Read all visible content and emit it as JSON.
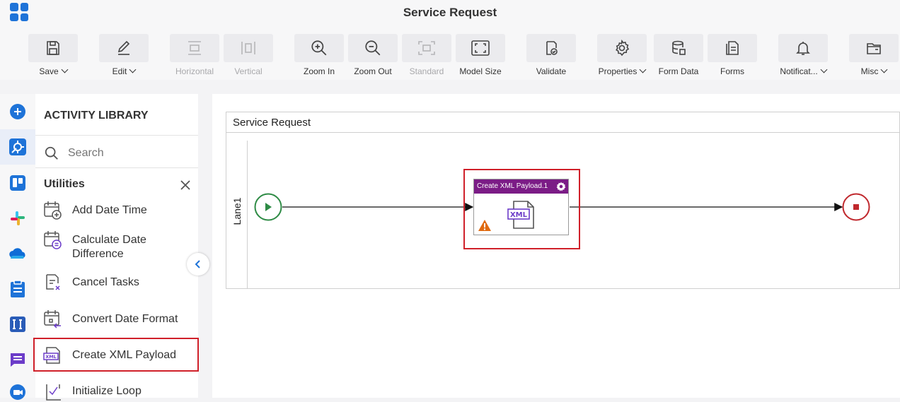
{
  "window": {
    "title": "Service Request"
  },
  "toolbar": {
    "save": "Save",
    "edit": "Edit",
    "horizontal": "Horizontal",
    "vertical": "Vertical",
    "zoom_in": "Zoom In",
    "zoom_out": "Zoom Out",
    "standard": "Standard",
    "model_size": "Model Size",
    "validate": "Validate",
    "properties": "Properties",
    "form_data": "Form Data",
    "forms": "Forms",
    "notifications": "Notificat...",
    "misc": "Misc"
  },
  "leftnav": {
    "icons": [
      "plus-circle-icon",
      "wrench-gear-icon",
      "trello-icon",
      "slack-icon",
      "onedrive-cloud-icon",
      "clipboard-icon",
      "text-input-icon",
      "chat-icon",
      "video-icon"
    ]
  },
  "library": {
    "title": "ACTIVITY LIBRARY",
    "search_placeholder": "Search",
    "group": "Utilities",
    "items": [
      {
        "label": "Add Date Time"
      },
      {
        "label": "Calculate Date\nDifference"
      },
      {
        "label": "Cancel Tasks"
      },
      {
        "label": "Convert Date Format"
      },
      {
        "label": "Create XML Payload"
      },
      {
        "label": "Initialize Loop"
      }
    ]
  },
  "canvas": {
    "pool_title": "Service Request",
    "lane": "Lane1",
    "task": {
      "title": "Create XML Payload.1",
      "icon_text": "XML"
    }
  },
  "colors": {
    "accent": "#1e73d8",
    "task_header": "#7b1c86",
    "highlight": "#d0202a",
    "start_event": "#2e8b45",
    "end_event": "#c0282d",
    "warning": "#e06a10"
  }
}
